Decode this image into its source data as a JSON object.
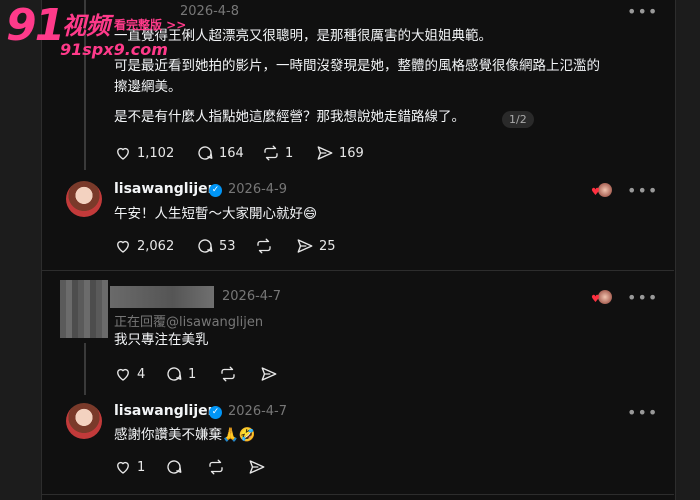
{
  "watermark": {
    "num": "91",
    "cn": "视频",
    "tag": "看完整版 >>",
    "url": "91spx9.com"
  },
  "post1": {
    "date": "2026-4-8",
    "paragraphs": [
      "一直覺得王俐人超漂亮又很聰明，是那種很厲害的大姐姐典範。",
      "可是最近看到她拍的影片，一時間沒發現是她，整體的風格感覺很像網路上氾濫的",
      "擦邊網美。",
      "是不是有什麼人指點她這麼經營？那我想說她走錯路線了。"
    ],
    "page_indicator": "1/2",
    "likes": "1,102",
    "replies": "164",
    "reposts": "1",
    "shares": "169"
  },
  "reply1": {
    "username": "lisawanglijen",
    "date": "2026-4-9",
    "text": "午安！人生短暫～大家開心就好😄",
    "likes": "2,062",
    "replies": "53",
    "shares": "25"
  },
  "post2": {
    "date": "2026-4-7",
    "replying_to": "正在回覆@lisawanglijen",
    "text": "我只專注在美乳",
    "likes": "4",
    "replies": "1"
  },
  "reply2": {
    "username": "lisawanglijen",
    "date": "2026-4-7",
    "text": "感謝你讚美不嫌棄🙏🤣",
    "likes": "1"
  },
  "icons": {
    "like": "heart-icon",
    "comment": "comment-icon",
    "repost": "repost-icon",
    "share": "share-icon",
    "more": "more-icon",
    "verified": "verified-badge-icon"
  },
  "colors": {
    "background": "#101010",
    "accent_verified": "#0095f6",
    "watermark": "#ff3a8a"
  }
}
